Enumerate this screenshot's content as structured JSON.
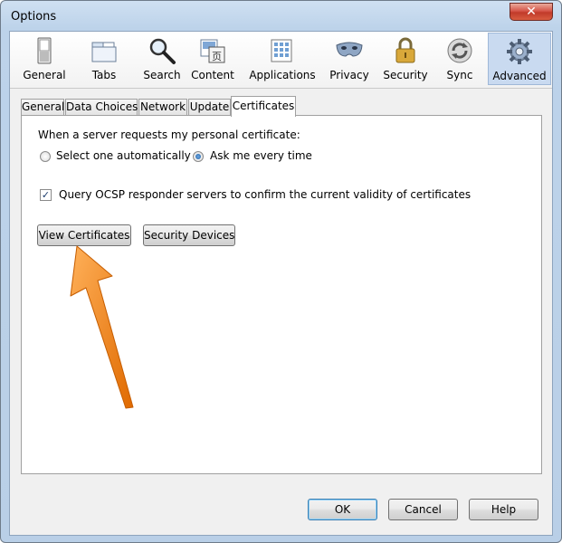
{
  "window": {
    "title": "Options",
    "close_glyph": "✕"
  },
  "toolbar": {
    "panes": [
      {
        "label": "General",
        "icon": "general-switch-icon"
      },
      {
        "label": "Tabs",
        "icon": "tabs-icon"
      },
      {
        "label": "Search",
        "icon": "magnifier-icon"
      },
      {
        "label": "Content",
        "icon": "content-icon"
      },
      {
        "label": "Applications",
        "icon": "applications-icon"
      },
      {
        "label": "Privacy",
        "icon": "privacy-mask-icon"
      },
      {
        "label": "Security",
        "icon": "padlock-icon"
      },
      {
        "label": "Sync",
        "icon": "sync-icon"
      },
      {
        "label": "Advanced",
        "icon": "gear-icon",
        "selected": true
      }
    ]
  },
  "tabs": [
    "General",
    "Data Choices",
    "Network",
    "Update",
    "Certificates"
  ],
  "active_tab": "Certificates",
  "certificates": {
    "prompt": "When a server requests my personal certificate:",
    "radio_auto": "Select one automatically",
    "radio_ask": "Ask me every time",
    "selected": "Ask me every time",
    "ocsp_label": "Query OCSP responder servers to confirm the current validity of certificates",
    "ocsp_checked": true,
    "view_certificates": "View Certificates",
    "security_devices": "Security Devices"
  },
  "footer": {
    "ok": "OK",
    "cancel": "Cancel",
    "help": "Help"
  },
  "colors": {
    "arrow": "#f07d10",
    "accent": "#c9daf0"
  }
}
